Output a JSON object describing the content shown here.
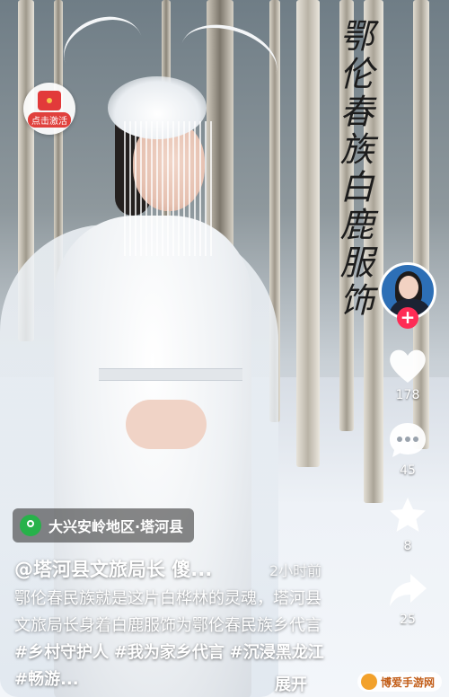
{
  "calligraphy": "鄂伦春族白鹿服饰",
  "activate_badge": {
    "label": "点击激活",
    "icon": "red-packet-icon"
  },
  "rail": {
    "avatar_icon": "creator-avatar",
    "follow_symbol": "+",
    "like": {
      "icon": "heart-icon",
      "count": "178"
    },
    "comment": {
      "icon": "comment-icon",
      "count": "45"
    },
    "favorite": {
      "icon": "star-icon",
      "count": "8"
    },
    "share": {
      "icon": "share-arrow-icon",
      "count": "25"
    }
  },
  "location": {
    "icon": "location-pin-icon",
    "text": "大兴安岭地区·塔河县"
  },
  "post": {
    "author": "@塔河县文旅局长 傻...",
    "time_ago": "2小时前",
    "caption_text": "鄂伦春民族就是这片白桦林的灵魂，塔河县文旅局长身着白鹿服饰为鄂伦春民族乡代言",
    "hashtags": [
      "#乡村守护人",
      "#我为家乡代言",
      "#沉浸黑龙江",
      "#畅游..."
    ],
    "expand_label": "展开"
  },
  "watermark": {
    "text": "博爱手游网"
  },
  "colors": {
    "follow": "#fe2c55",
    "location": "#27b24a",
    "badge": "#e0413d"
  }
}
